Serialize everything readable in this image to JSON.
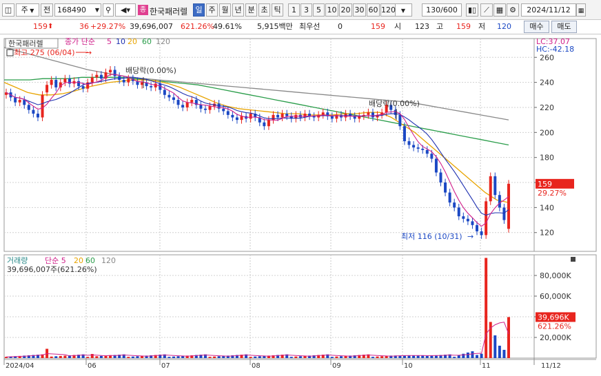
{
  "toolbar": {
    "market_label": "주",
    "jeon_label": "전",
    "code": "168490",
    "stock_name": "한국패러렐",
    "stock_badge": "종",
    "periods": [
      "일",
      "주",
      "월",
      "년",
      "분",
      "초",
      "틱"
    ],
    "active_period": "일",
    "numbers": [
      "1",
      "3",
      "5",
      "10",
      "20",
      "30",
      "60",
      "120"
    ],
    "count": "130/600",
    "date": "2024/11/12"
  },
  "info": {
    "price": "159",
    "change": "36",
    "change_pct": "+29.27%",
    "volume": "39,696,007",
    "volume_pct": "621.26%",
    "rate": "49.61%",
    "amount": "5,915백만",
    "priority_label": "최우선",
    "priority_value": "0",
    "priority_price": "159",
    "open_label": "시",
    "open": "123",
    "high_label": "고",
    "high": "159",
    "low_label": "저",
    "low": "120",
    "buy_button": "매수",
    "sell_button": "매도"
  },
  "chart_data": [
    {
      "type": "candlestick",
      "title": "한국패러렐",
      "legend": [
        "종가 단순",
        "5",
        "10",
        "20",
        "60",
        "120"
      ],
      "legend_colors": {
        "종가 단순": "#d01f8a",
        "5": "#d01f8a",
        "10": "#1d2fb0",
        "20": "#e8a400",
        "60": "#2a9d4a",
        "120": "#888888"
      },
      "ylim": [
        105,
        275
      ],
      "y_ticks": [
        120,
        140,
        160,
        180,
        200,
        220,
        240,
        260
      ],
      "x_labels": [
        "2024/04",
        "06",
        "07",
        "08",
        "09",
        "10",
        "11",
        "11/12"
      ],
      "lc": "LC:37.07",
      "hc": "HC:-42.18",
      "annotations": {
        "high": "최고 275 (06/04)",
        "low": "최저 116 (10/31)",
        "dividend1": "배당락(0.00%)",
        "dividend2": "배당락(0.00%)"
      },
      "last_price_label": "159",
      "last_pct_label": "29.27%",
      "closes": [
        232,
        228,
        224,
        226,
        222,
        218,
        215,
        212,
        230,
        238,
        242,
        236,
        240,
        243,
        239,
        241,
        237,
        235,
        240,
        244,
        246,
        243,
        248,
        250,
        245,
        242,
        240,
        243,
        241,
        238,
        240,
        237,
        236,
        239,
        234,
        230,
        228,
        226,
        222,
        220,
        224,
        226,
        222,
        219,
        218,
        221,
        223,
        219,
        217,
        214,
        212,
        210,
        213,
        211,
        215,
        212,
        208,
        205,
        210,
        214,
        212,
        215,
        213,
        211,
        214,
        212,
        215,
        213,
        212,
        214,
        216,
        213,
        211,
        214,
        212,
        215,
        213,
        211,
        213,
        214,
        216,
        212,
        214,
        216,
        222,
        218,
        214,
        205,
        193,
        190,
        188,
        187,
        186,
        183,
        179,
        168,
        160,
        152,
        144,
        140,
        133,
        131,
        129,
        126,
        121,
        118,
        145,
        165,
        150,
        140,
        130,
        159
      ],
      "opens": [
        230,
        232,
        228,
        224,
        226,
        222,
        218,
        215,
        212,
        232,
        238,
        242,
        236,
        240,
        243,
        239,
        241,
        237,
        235,
        240,
        244,
        246,
        243,
        248,
        250,
        245,
        242,
        240,
        243,
        241,
        238,
        240,
        237,
        236,
        239,
        234,
        230,
        228,
        226,
        222,
        220,
        224,
        226,
        222,
        219,
        218,
        221,
        223,
        219,
        217,
        214,
        212,
        210,
        213,
        211,
        215,
        212,
        208,
        205,
        210,
        214,
        212,
        215,
        213,
        211,
        214,
        212,
        215,
        213,
        212,
        214,
        216,
        213,
        211,
        214,
        212,
        215,
        213,
        211,
        213,
        214,
        216,
        212,
        214,
        216,
        222,
        218,
        214,
        205,
        193,
        190,
        188,
        187,
        186,
        183,
        179,
        168,
        160,
        152,
        144,
        140,
        133,
        131,
        129,
        126,
        121,
        118,
        145,
        165,
        150,
        140,
        123
      ],
      "ma": {
        "120": [
          268,
          265,
          262,
          259,
          256,
          253,
          250,
          248,
          246,
          244,
          243,
          242,
          241,
          240,
          239,
          238,
          237,
          236,
          235,
          234,
          233,
          232,
          231,
          230,
          229,
          228,
          227,
          226,
          225,
          224,
          222,
          220,
          218,
          216,
          214,
          212,
          210
        ],
        "60": [
          242,
          242,
          242,
          243,
          243,
          243,
          244,
          244,
          244,
          244,
          243,
          242,
          241,
          240,
          239,
          238,
          236,
          234,
          232,
          230,
          228,
          226,
          224,
          222,
          220,
          218,
          216,
          214,
          212,
          210,
          208,
          206,
          204,
          202,
          200,
          198,
          196,
          194,
          192,
          190
        ],
        "20": [
          240,
          236,
          232,
          230,
          230,
          231,
          233,
          236,
          238,
          240,
          241,
          242,
          242,
          241,
          239,
          236,
          232,
          228,
          224,
          221,
          219,
          218,
          217,
          216,
          215,
          215,
          214,
          214,
          214,
          215,
          215,
          216,
          216,
          212,
          206,
          200,
          192,
          184,
          176,
          168,
          160,
          152,
          146,
          144
        ]
      }
    },
    {
      "type": "bar",
      "title": "거래량",
      "legend": [
        "거래량",
        "단순 5",
        "20",
        "60",
        "120"
      ],
      "ylim": [
        0,
        100000
      ],
      "y_ticks": [
        20000,
        40000,
        60000,
        80000
      ],
      "y_tick_labels": [
        "20,000K",
        "40,000K",
        "60,000K",
        "80,000K"
      ],
      "summary": "39,696,007주(621.26%)",
      "last_label": "39,696K",
      "last_pct_label": "621.26%",
      "last_value": 39696
    }
  ]
}
